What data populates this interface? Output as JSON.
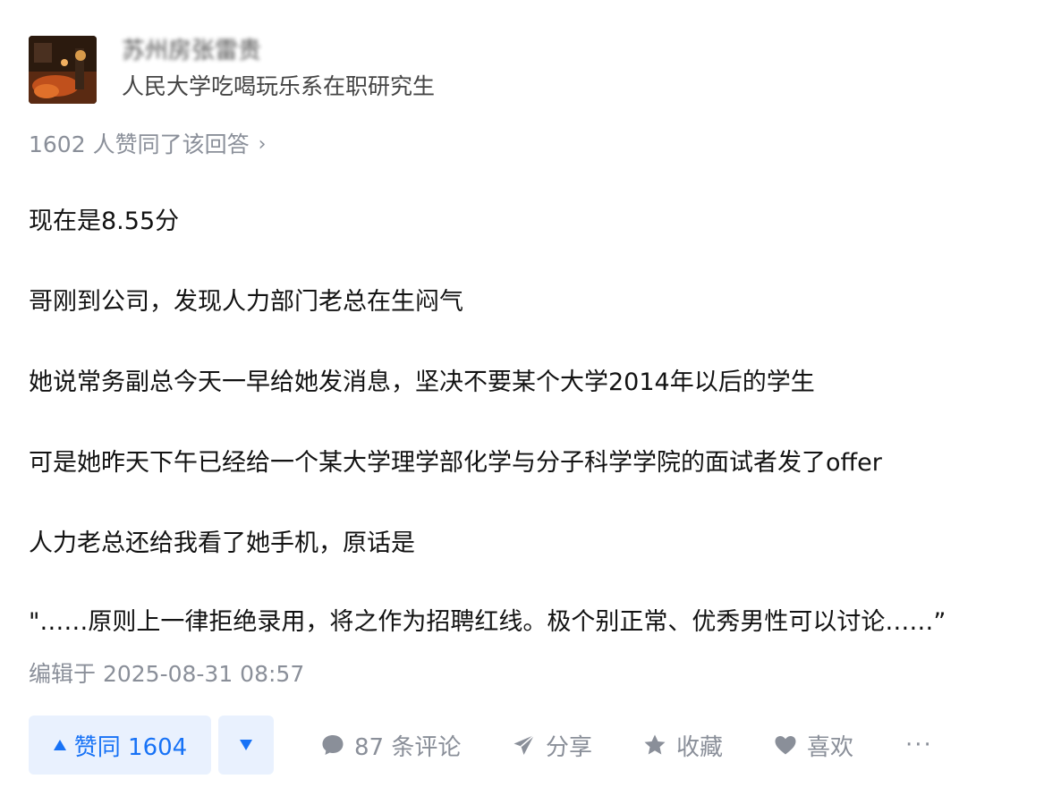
{
  "author": {
    "name": "苏州房张雷贵",
    "bio": "人民大学吃喝玩乐系在职研究生"
  },
  "agree_line": {
    "text": "1602 人赞同了该回答",
    "chevron": "›"
  },
  "content": {
    "paragraphs": [
      "现在是8.55分",
      "哥刚到公司，发现人力部门老总在生闷气",
      "她说常务副总今天一早给她发消息，坚决不要某个大学2014年以后的学生",
      "可是她昨天下午已经给一个某大学理学部化学与分子科学学院的面试者发了offer",
      "人力老总还给我看了她手机，原话是",
      "\"……原则上一律拒绝录用，将之作为招聘红线。极个别正常、优秀男性可以讨论……”"
    ]
  },
  "edited": "编辑于 2025-08-31 08:57",
  "actions": {
    "upvote_label": "赞同 1604",
    "comments_label": "87 条评论",
    "share_label": "分享",
    "collect_label": "收藏",
    "like_label": "喜欢",
    "more_label": "···"
  },
  "colors": {
    "accent": "#1772f6",
    "accent_bg": "#e9f1fe",
    "muted": "#8a8f99"
  },
  "icons": {
    "upvote": "triangle-up-icon",
    "downvote": "triangle-down-icon",
    "comment": "comment-bubble-icon",
    "share": "paper-plane-icon",
    "collect": "star-icon",
    "like": "heart-icon"
  }
}
